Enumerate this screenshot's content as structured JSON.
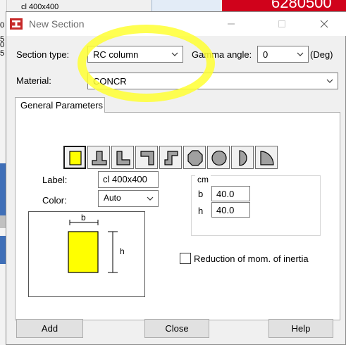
{
  "background": {
    "tree_item": "cl 400x400",
    "red_value": "6280500",
    "left_marks": [
      "0",
      "5",
      "0",
      "5"
    ]
  },
  "dialog": {
    "title": "New Section",
    "section_type_label": "Section type:",
    "section_type_value": "RC column",
    "gamma_angle_label": "Gamma angle:",
    "gamma_angle_value": "0",
    "gamma_unit": "(Deg)",
    "material_label": "Material:",
    "material_value": "CONCR",
    "tab_label": "General Parameters",
    "shapes": [
      "rectangle",
      "t-section",
      "l-section",
      "z-section",
      "octagon",
      "circle",
      "half-circle",
      "quarter-circle"
    ],
    "label_label": "Label:",
    "label_value": "cl 400x400",
    "color_label": "Color:",
    "color_value": "Auto",
    "units": "cm",
    "dims": [
      {
        "name": "b",
        "value": "40.0"
      },
      {
        "name": "h",
        "value": "40.0"
      }
    ],
    "preview_b": "b",
    "preview_h": "h",
    "reduction_label": "Reduction of mom. of inertia",
    "buttons": {
      "add": "Add",
      "close": "Close",
      "help": "Help"
    },
    "colors": {
      "section_fill": "#ffff00",
      "shape_fill": "#a0a0a0",
      "highlight": "#ffff33"
    }
  }
}
